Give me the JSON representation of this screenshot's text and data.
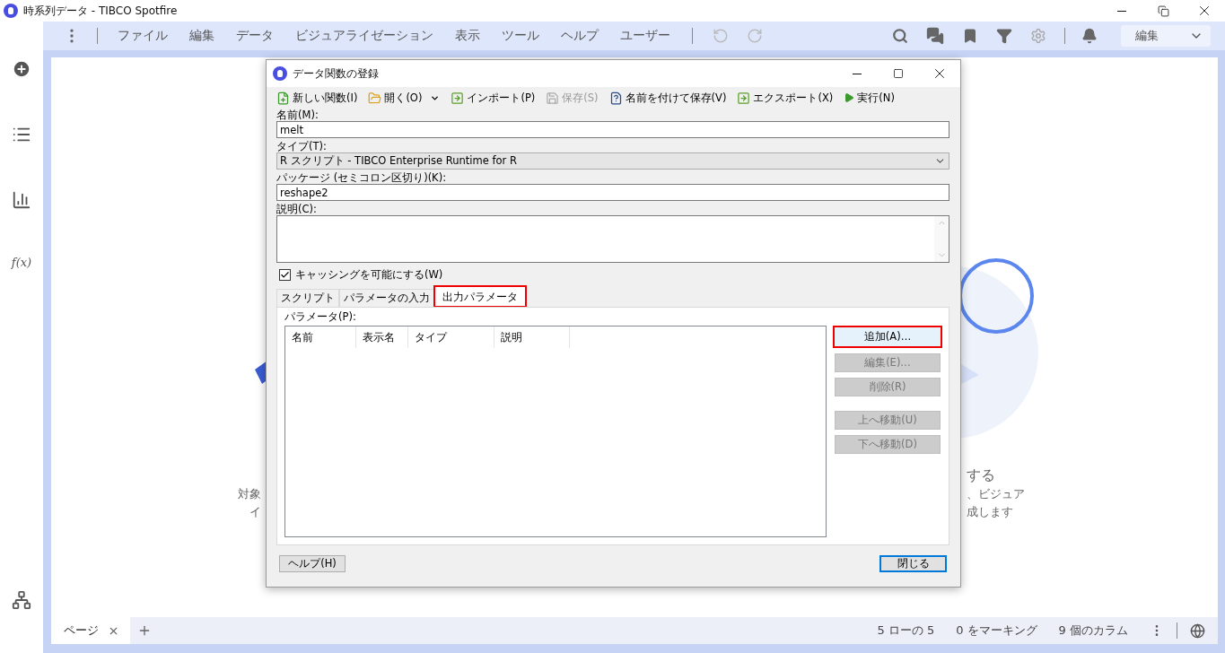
{
  "window": {
    "title": "時系列データ - TIBCO Spotfire"
  },
  "menu": [
    "ファイル",
    "編集",
    "データ",
    "ビジュアライゼーション",
    "表示",
    "ツール",
    "ヘルプ",
    "ユーザー"
  ],
  "mode_select": {
    "value": "編集"
  },
  "sidebar": {
    "formula_label": "f(x)"
  },
  "background_texts": [
    {
      "text": "対象"
    },
    {
      "text": "イ"
    },
    {
      "text": "する"
    },
    {
      "text": "、ビジュア"
    },
    {
      "text": "成します"
    }
  ],
  "dialog": {
    "title": "データ関数の登録",
    "toolbar": [
      {
        "kind": "new",
        "label": "新しい関数(I)",
        "disabled": false
      },
      {
        "kind": "open",
        "label": "開く(O)",
        "disabled": false,
        "dropdown": true
      },
      {
        "kind": "import",
        "label": "インポート(P)",
        "disabled": false
      },
      {
        "kind": "save",
        "label": "保存(S)",
        "disabled": true
      },
      {
        "kind": "save-as",
        "label": "名前を付けて保存(V)",
        "disabled": false
      },
      {
        "kind": "export",
        "label": "エクスポート(X)",
        "disabled": false
      },
      {
        "kind": "run",
        "label": "実行(N)",
        "disabled": false
      }
    ],
    "name": {
      "label": "名前(M):",
      "value": "melt"
    },
    "type": {
      "label": "タイプ(T):",
      "value": "R スクリプト - TIBCO Enterprise Runtime for R"
    },
    "packages": {
      "label": "パッケージ (セミコロン区切り)(K):",
      "value": "reshape2"
    },
    "description": {
      "label": "説明(C):"
    },
    "caching": {
      "label": "キャッシングを可能にする(W)",
      "checked": true
    },
    "tabs": [
      {
        "label": "スクリプト",
        "selected": false,
        "highlighted": false
      },
      {
        "label": "パラメータの入力",
        "selected": false,
        "highlighted": false
      },
      {
        "label": "出力パラメータ",
        "selected": true,
        "highlighted": true
      }
    ],
    "parameters_label": "パラメータ(P):",
    "columns": [
      "名前",
      "表示名",
      "タイプ",
      "説明"
    ],
    "side_button_groups": [
      {
        "buttons": [
          {
            "label": "追加(A)…",
            "disabled": false,
            "highlighted": true
          },
          {
            "label": "編集(E)…",
            "disabled": true,
            "highlighted": false
          },
          {
            "label": "削除(R)",
            "disabled": true,
            "highlighted": false
          }
        ]
      },
      {
        "buttons": [
          {
            "label": "上へ移動(U)",
            "disabled": true,
            "highlighted": false
          },
          {
            "label": "下へ移動(D)",
            "disabled": true,
            "highlighted": false
          }
        ]
      }
    ],
    "help_button": "ヘルプ(H)",
    "close_button": "閉じる"
  },
  "page_tabs": [
    {
      "label": "ページ",
      "selected": true
    }
  ],
  "status": [
    "5 ローの 5",
    "0 をマーキング",
    "9 個のカラム"
  ]
}
